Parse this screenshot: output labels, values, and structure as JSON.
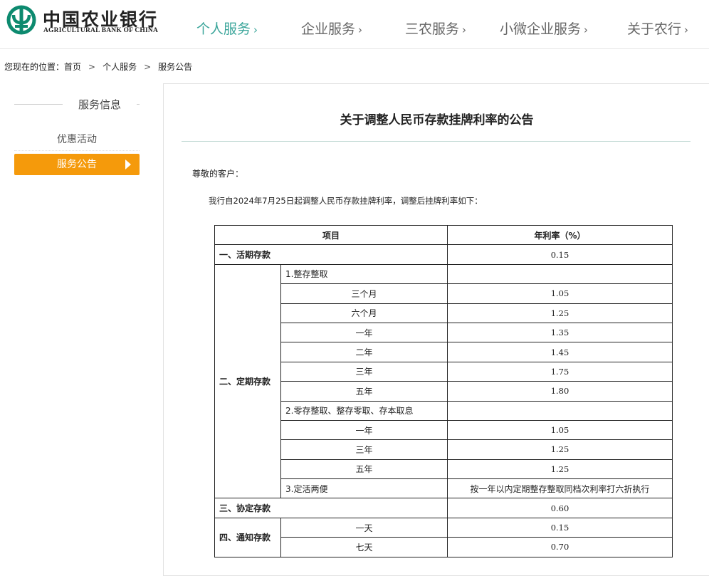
{
  "brand": {
    "name_cn": "中国农业银行",
    "name_en": "AGRICULTURAL BANK OF CHINA",
    "colors": {
      "green": "#0d8a6f",
      "accent_teal": "#3aa59a",
      "orange": "#f59a0b"
    }
  },
  "nav": {
    "items": [
      {
        "label": "个人服务",
        "active": true
      },
      {
        "label": "企业服务"
      },
      {
        "label": "三农服务"
      },
      {
        "label": "小微企业服务"
      },
      {
        "label": "关于农行"
      }
    ],
    "chevron": "›"
  },
  "breadcrumb": {
    "prefix": "您现在的位置：",
    "items": [
      "首页",
      "个人服务",
      "服务公告"
    ],
    "sep": ">"
  },
  "sidebar": {
    "title": "服务信息",
    "items": [
      {
        "label": "优惠活动",
        "active": false
      },
      {
        "label": "服务公告",
        "active": true
      }
    ]
  },
  "article": {
    "title": "关于调整人民币存款挂牌利率的公告",
    "greeting": "尊敬的客户：",
    "intro": "我行自2024年7月25日起调整人民币存款挂牌利率，调整后挂牌利率如下："
  },
  "table": {
    "headers": [
      "项目",
      "年利率（%）"
    ],
    "demand": {
      "label": "一、活期存款",
      "rate": "0.15"
    },
    "fixed": {
      "label": "二、定期存款",
      "group1": {
        "label": "1.整存整取",
        "rows": [
          {
            "term": "三个月",
            "rate": "1.05"
          },
          {
            "term": "六个月",
            "rate": "1.25"
          },
          {
            "term": "一年",
            "rate": "1.35"
          },
          {
            "term": "二年",
            "rate": "1.45"
          },
          {
            "term": "三年",
            "rate": "1.75"
          },
          {
            "term": "五年",
            "rate": "1.80"
          }
        ]
      },
      "group2": {
        "label": "2.零存整取、整存零取、存本取息",
        "rows": [
          {
            "term": "一年",
            "rate": "1.05"
          },
          {
            "term": "三年",
            "rate": "1.25"
          },
          {
            "term": "五年",
            "rate": "1.25"
          }
        ]
      },
      "group3": {
        "label": "3.定活两便",
        "rate": "按一年以内定期整存整取同档次利率打六折执行"
      }
    },
    "agreement": {
      "label": "三、协定存款",
      "rate": "0.60"
    },
    "notice": {
      "label": "四、通知存款",
      "rows": [
        {
          "term": "一天",
          "rate": "0.15"
        },
        {
          "term": "七天",
          "rate": "0.70"
        }
      ]
    }
  }
}
